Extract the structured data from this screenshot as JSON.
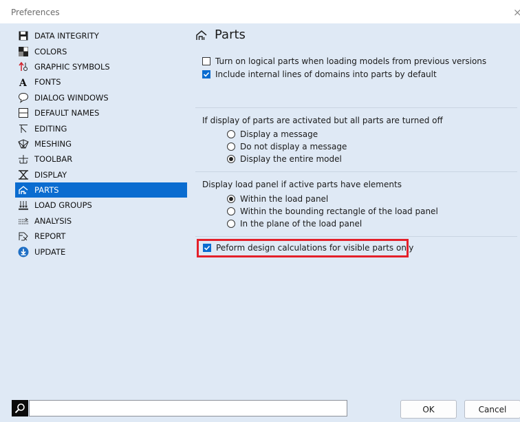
{
  "window": {
    "title": "Preferences",
    "close_glyph": "×"
  },
  "sidebar": {
    "items": [
      {
        "label": "DATA INTEGRITY",
        "icon": "floppy-disk-icon"
      },
      {
        "label": "COLORS",
        "icon": "color-palette-icon"
      },
      {
        "label": "GRAPHIC SYMBOLS",
        "icon": "graphic-symbols-icon"
      },
      {
        "label": "FONTS",
        "icon": "font-icon"
      },
      {
        "label": "DIALOG WINDOWS",
        "icon": "speech-bubble-icon"
      },
      {
        "label": "DEFAULT NAMES",
        "icon": "table-icon"
      },
      {
        "label": "EDITING",
        "icon": "editing-icon"
      },
      {
        "label": "MESHING",
        "icon": "meshing-icon"
      },
      {
        "label": "TOOLBAR",
        "icon": "toolbar-icon"
      },
      {
        "label": "DISPLAY",
        "icon": "display-icon"
      },
      {
        "label": "PARTS",
        "icon": "parts-icon",
        "active": true
      },
      {
        "label": "LOAD GROUPS",
        "icon": "load-groups-icon"
      },
      {
        "label": "ANALYSIS",
        "icon": "analysis-icon"
      },
      {
        "label": "REPORT",
        "icon": "report-icon"
      },
      {
        "label": "UPDATE",
        "icon": "update-icon"
      }
    ]
  },
  "panel": {
    "title": "Parts",
    "checkbox_logical": "Turn on logical parts when loading models from previous versions",
    "checkbox_internal": "Include internal lines of domains into parts by default",
    "group1_label": "If display of parts are activated but all parts are turned off",
    "group1_options": [
      "Display a message",
      "Do not display a message",
      "Display the entire model"
    ],
    "group1_selected": 2,
    "group2_label": "Display load panel if active parts have elements",
    "group2_options": [
      "Within the load panel",
      "Within the bounding rectangle of the load panel",
      "In the plane of the load panel"
    ],
    "group2_selected": 0,
    "checkbox_design": "Peform design calculations for visible parts only"
  },
  "footer": {
    "search_value": "",
    "ok_label": "OK",
    "cancel_label": "Cancel"
  },
  "colors": {
    "accent": "#0a6cd0",
    "highlight_border": "#e4202a",
    "background": "#dfe9f5"
  }
}
